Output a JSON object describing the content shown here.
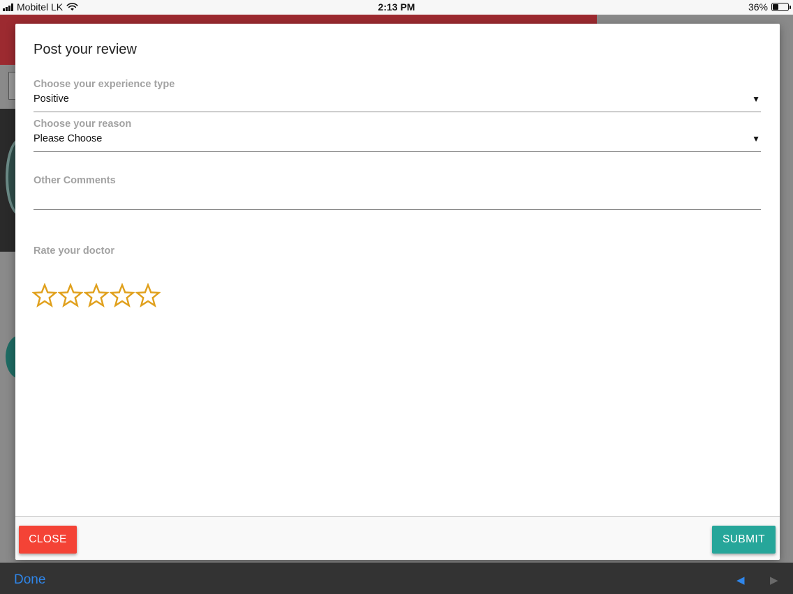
{
  "status_bar": {
    "carrier": "Mobitel LK",
    "time": "2:13 PM",
    "battery": "36%",
    "battery_level": 0.36
  },
  "modal": {
    "title": "Post your review",
    "experience_type": {
      "label": "Choose your experience type",
      "value": "Positive"
    },
    "reason": {
      "label": "Choose your reason",
      "value": "Please Choose"
    },
    "comments": {
      "label": "Other Comments",
      "value": ""
    },
    "rating": {
      "label": "Rate your doctor",
      "max": 5,
      "value": 0,
      "star_color": "#e0a01c"
    },
    "footer": {
      "close_label": "CLOSE",
      "submit_label": "SUBMIT"
    }
  },
  "colors": {
    "close": "#f44336",
    "submit": "#26a69a",
    "link": "#2f86ea"
  },
  "keyboard_toolbar": {
    "done_label": "Done",
    "prev_icon": "left-arrow-icon",
    "next_icon": "right-arrow-icon"
  }
}
